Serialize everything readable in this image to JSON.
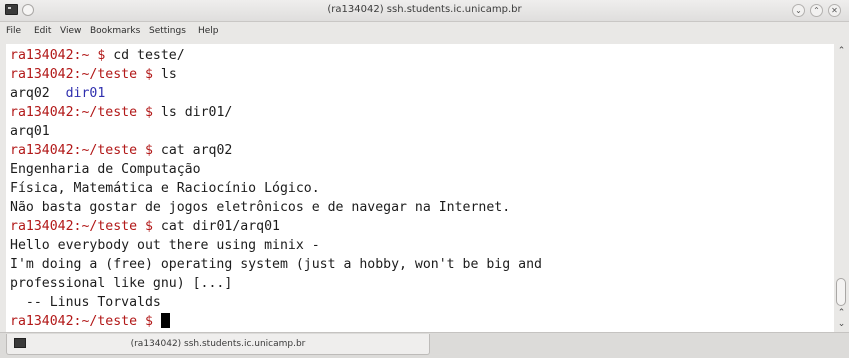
{
  "window": {
    "title": "(ra134042) ssh.students.ic.unicamp.br",
    "icon": "terminal-app-icon",
    "controls": [
      "minimize-icon",
      "maximize-icon",
      "close-icon"
    ]
  },
  "menubar": {
    "items": [
      "File",
      "Edit",
      "View",
      "Bookmarks",
      "Settings",
      "Help"
    ]
  },
  "terminal": {
    "prompt_home": "ra134042:~ $ ",
    "prompt_teste_user": "ra134042:",
    "prompt_teste_path": "~/teste $ ",
    "lines": {
      "l0_cmd": "cd teste/",
      "l1_cmd": "ls",
      "l2_file": "arq02  ",
      "l2_dir": "dir01",
      "l3_cmd": "ls dir01/",
      "l4": "arq01",
      "l5_cmd": "cat arq02",
      "l6": "Engenharia de Computação",
      "l7": "Física, Matemática e Raciocínio Lógico.",
      "l8": "Não basta gostar de jogos eletrônicos e de navegar na Internet.",
      "l9_cmd": "cat dir01/arq01",
      "l10": "Hello everybody out there using minix -",
      "l11": "I'm doing a (free) operating system (just a hobby, won't be big and",
      "l12": "professional like gnu) [...]",
      "l13": "  -- Linus Torvalds"
    }
  },
  "tabbar": {
    "tab_label": "(ra134042) ssh.students.ic.unicamp.br"
  },
  "colors": {
    "prompt_user": "#b21818",
    "prompt_path": "#2f2fae",
    "directory": "#2f2fae",
    "text": "#1c1c1c",
    "background": "#ffffff"
  }
}
